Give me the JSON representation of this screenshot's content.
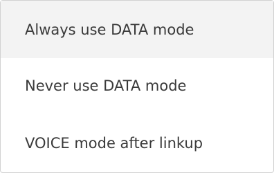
{
  "menu": {
    "items": [
      {
        "label": "Always use DATA mode",
        "selected": true
      },
      {
        "label": "Never use DATA mode",
        "selected": false
      },
      {
        "label": "VOICE mode after linkup",
        "selected": false
      }
    ]
  },
  "colors": {
    "selected_background": "#f3f3f3",
    "text": "#3a3a3a",
    "border": "#d2d2d2"
  }
}
